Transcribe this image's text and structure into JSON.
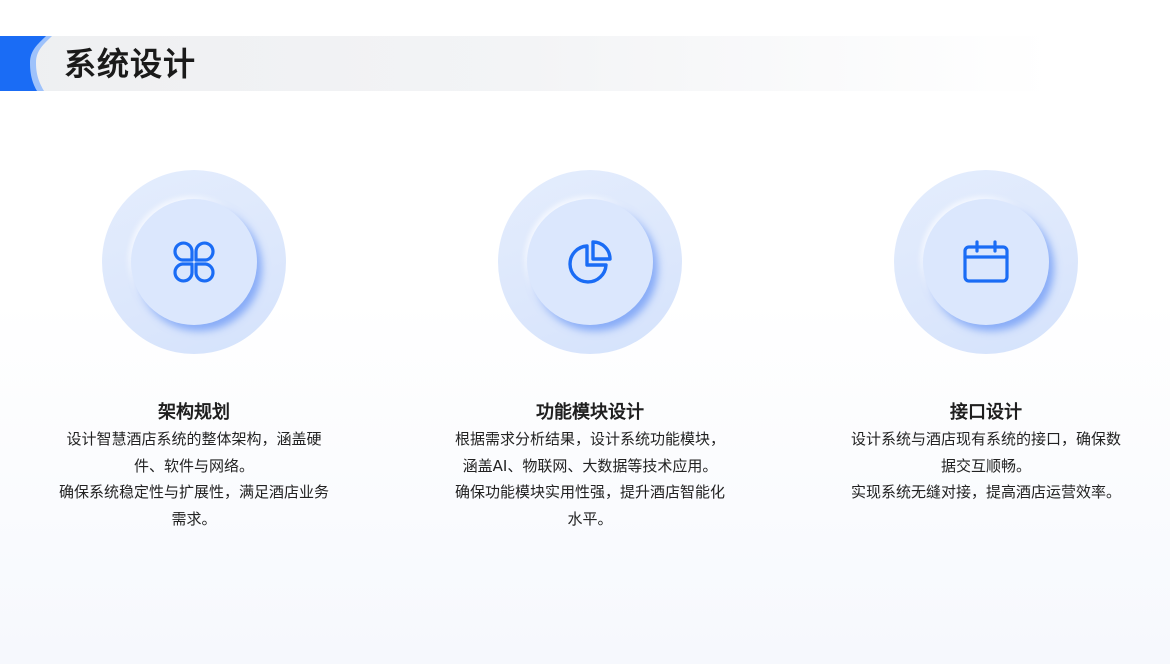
{
  "header": {
    "title": "系统设计"
  },
  "colors": {
    "accent": "#1a6cf5",
    "accent_light": "#9ec2fb",
    "circle_bg": "#dbe7fd"
  },
  "cards": [
    {
      "icon": "grid-four-petal-icon",
      "title": "架构规划",
      "paragraphs": [
        "设计智慧酒店系统的整体架构，涵盖硬件、软件与网络。",
        "确保系统稳定性与扩展性，满足酒店业务需求。"
      ]
    },
    {
      "icon": "pie-chart-icon",
      "title": "功能模块设计",
      "paragraphs": [
        "根据需求分析结果，设计系统功能模块，涵盖AI、物联网、大数据等技术应用。",
        "确保功能模块实用性强，提升酒店智能化水平。"
      ]
    },
    {
      "icon": "calendar-icon",
      "title": "接口设计",
      "paragraphs": [
        "设计系统与酒店现有系统的接口，确保数据交互顺畅。",
        "实现系统无缝对接，提高酒店运营效率。"
      ]
    }
  ]
}
